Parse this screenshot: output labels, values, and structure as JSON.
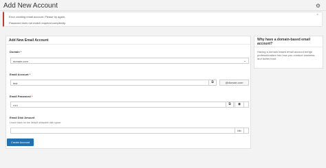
{
  "page": {
    "title": "Add New Account"
  },
  "alert": {
    "line1": "Error creating email account. Please try again.",
    "line2": "Password does not match required complexity.",
    "close": "×"
  },
  "form": {
    "heading": "Add New Email Account",
    "domain": {
      "label": "Domain",
      "required": "*",
      "value": "domain.com"
    },
    "email": {
      "label": "Email Account",
      "required": "*",
      "value": "test",
      "suffix": "@domain.com"
    },
    "password": {
      "label": "Email Password",
      "required": "*",
      "value": "•••••"
    },
    "disk": {
      "label": "Email Disk Amount",
      "hint": "Leave blank for the default allowable disk space.",
      "value": "",
      "unit": "Mb"
    },
    "submit": "Create Account"
  },
  "sidebar": {
    "title": "Why have a domain-based email account?",
    "body": "Having a domain based email account brings professionalism into how you conduct business and builds trust."
  },
  "icons": {
    "help": "help-icon",
    "copy": "copy-icon",
    "eye": "eye-icon",
    "chevron": "chevron-down-icon"
  },
  "colors": {
    "error": "#c0392b",
    "primary": "#2271b1"
  }
}
